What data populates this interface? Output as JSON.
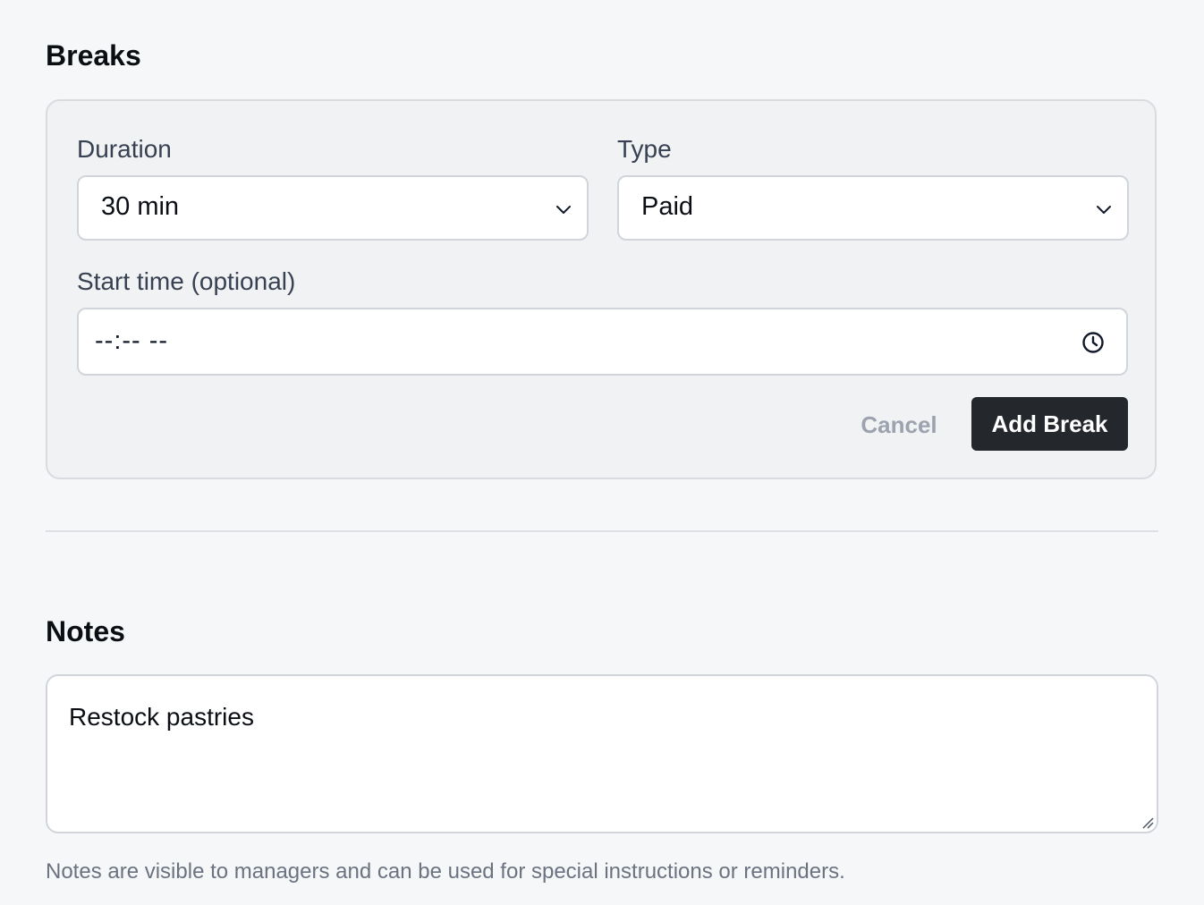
{
  "breaks": {
    "title": "Breaks",
    "duration": {
      "label": "Duration",
      "value": "30 min"
    },
    "type": {
      "label": "Type",
      "value": "Paid"
    },
    "start_time": {
      "label": "Start time (optional)",
      "placeholder": "--:-- --"
    },
    "cancel_label": "Cancel",
    "add_label": "Add Break"
  },
  "notes": {
    "title": "Notes",
    "value": "Restock pastries",
    "help": "Notes are visible to managers and can be used for special instructions or reminders."
  },
  "icons": {
    "select_chevron": "chevron-down-icon",
    "time_picker": "clock-icon",
    "resize": "resize-handle-icon"
  },
  "colors": {
    "primary_button": "#24272c",
    "muted_text": "#6b7280",
    "cancel_text": "#9ca3af"
  }
}
